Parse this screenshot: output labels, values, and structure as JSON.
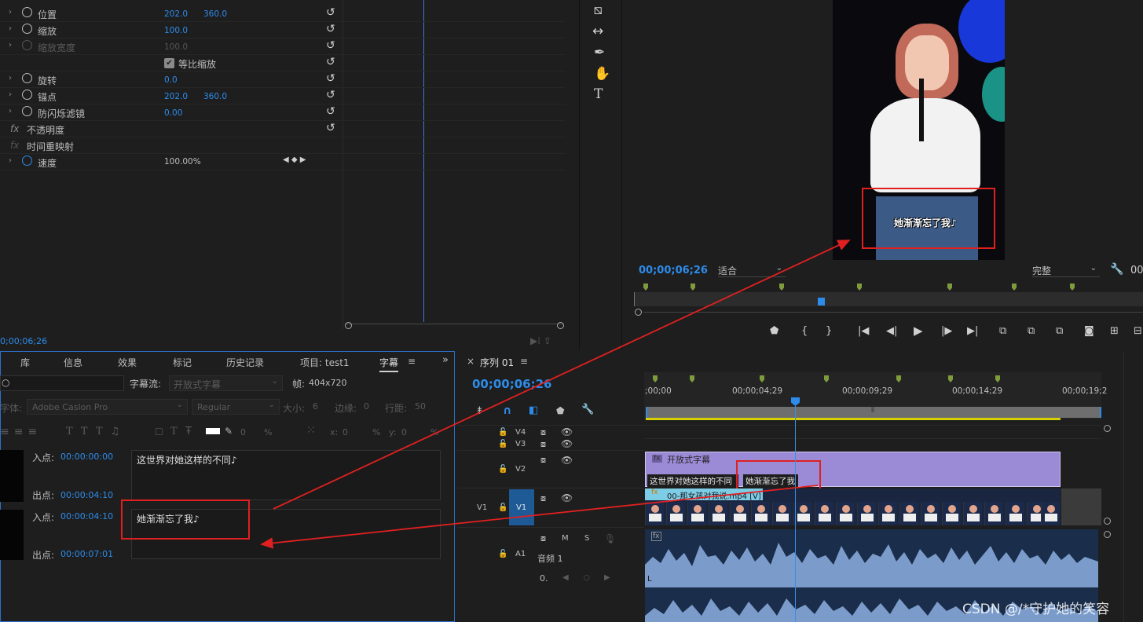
{
  "effect_controls": {
    "rows": [
      {
        "label": "位置",
        "v1": "202.0",
        "v2": "360.0"
      },
      {
        "label": "缩放",
        "v1": "100.0",
        "v2": ""
      },
      {
        "label": "缩放宽度",
        "v1": "100.0",
        "v2": ""
      },
      {
        "label": "等比缩放",
        "v1": "",
        "v2": ""
      },
      {
        "label": "旋转",
        "v1": "0.0",
        "v2": ""
      },
      {
        "label": "锚点",
        "v1": "202.0",
        "v2": "360.0"
      },
      {
        "label": "防闪烁滤镜",
        "v1": "0.00",
        "v2": ""
      },
      {
        "label": "不透明度",
        "v1": "",
        "v2": ""
      },
      {
        "label": "时间重映射",
        "v1": "",
        "v2": ""
      },
      {
        "label": "速度",
        "v1": "100.00%",
        "v2": ""
      }
    ],
    "fx_symbol": "fx",
    "timecode": "0;00;06;26"
  },
  "program_monitor": {
    "timecode": "00;00;06;26",
    "fit": "适合",
    "quality": "完整",
    "caption_on_video": "她渐渐忘了我♪",
    "right_tc_partial": "00"
  },
  "captions_panel": {
    "tabs": [
      "库",
      "信息",
      "效果",
      "标记",
      "历史记录",
      "项目: test1",
      "字幕"
    ],
    "active_tab": "字幕",
    "stream_label": "字幕流:",
    "stream_value": "开放式字幕",
    "frame_label": "帧:",
    "frame_value": "404x720",
    "font_label": "字体:",
    "font_value": "Adobe Caslon Pro",
    "style_value": "Regular",
    "size_label": "大小:",
    "size_value": "6",
    "edge_label": "边缘:",
    "edge_value": "0",
    "spacing_label": "行距:",
    "spacing_value": "50",
    "x_label": "x:",
    "x_value": "0",
    "y_label": "y:",
    "y_value": "0",
    "pct": "%",
    "pct2": "%",
    "zero_a": "0",
    "entries": [
      {
        "in_label": "入点:",
        "in": "00:00:00:00",
        "out_label": "出点:",
        "out": "00:00:04:10",
        "text": "这世界对她这样的不同♪"
      },
      {
        "in_label": "入点:",
        "in": "00:00:04:10",
        "out_label": "出点:",
        "out": "00:00:07:01",
        "text": "她渐渐忘了我♪"
      }
    ]
  },
  "timeline": {
    "title": "序列 01",
    "timecode": "00;00;06;26",
    "ruler": [
      ";00;00",
      "00;00;04;29",
      "00;00;09;29",
      "00;00;14;29",
      "00;00;19;2"
    ],
    "tracks": {
      "v4": "V4",
      "v3": "V3",
      "v2": "V2",
      "v1_src": "V1",
      "v1": "V1",
      "a1": "A1"
    },
    "audio_track_name": "音频 1",
    "clip_caption_title": "开放式字幕",
    "caption_clip_1": "这世界对她这样的不同",
    "caption_clip_2": "她渐渐忘了我",
    "video_clip": "00-那女孩对我说.mp4 [V]",
    "audio_m": "M",
    "audio_s": "S",
    "zero": "0.",
    "marker_l": "L",
    "fx_label": "fx"
  },
  "watermark": "CSDN @/*守护她的笑容",
  "colors": {
    "accent": "#2d8ceb",
    "annotation": "#e02020",
    "caption_clip": "#9b8bd6",
    "video_clip": "#7ecde6",
    "audio": "#6f8fb8"
  }
}
